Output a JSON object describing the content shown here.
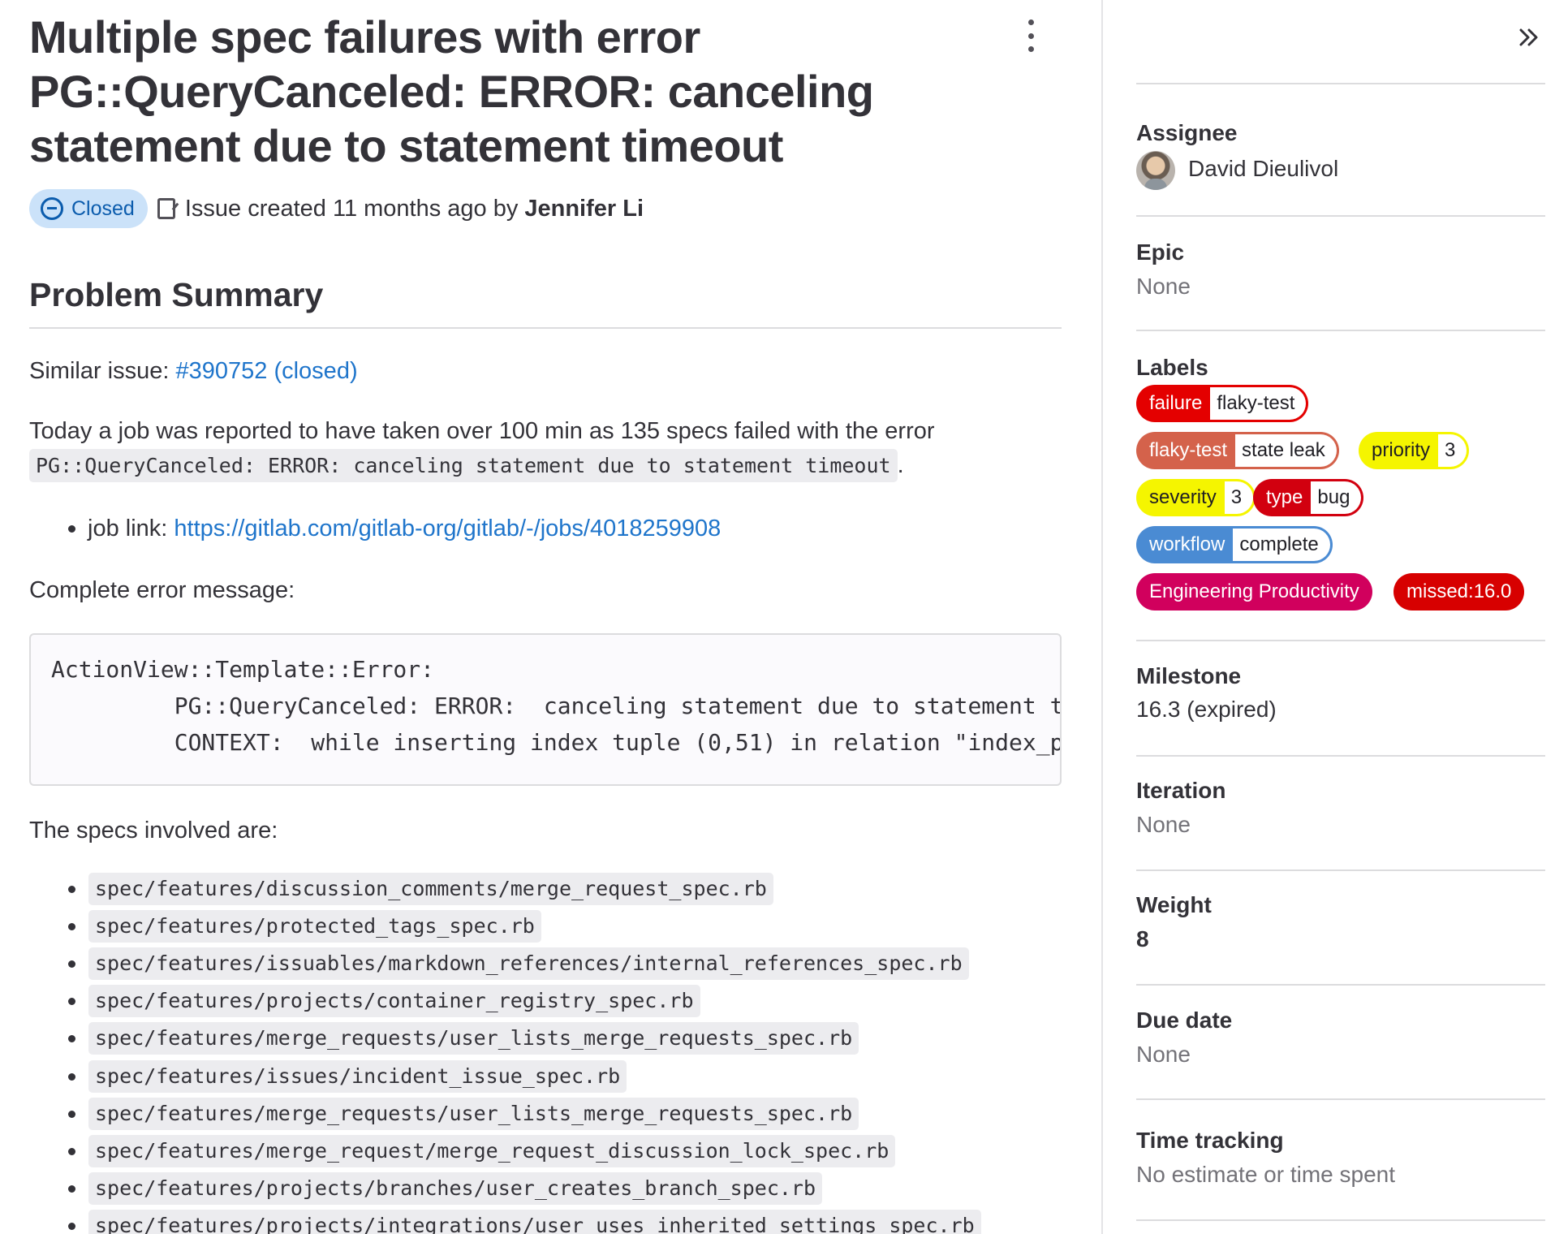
{
  "issue": {
    "title": "Multiple spec failures with error PG::QueryCanceled: ERROR: canceling statement due to statement timeout",
    "status": "Closed",
    "created_text": "Issue created 11 months ago by",
    "author": "Jennifer Li"
  },
  "description": {
    "heading": "Problem Summary",
    "similar_prefix": "Similar issue:",
    "similar_link": "#390752 (closed)",
    "intro_text": "Today a job was reported to have taken over 100 min as 135 specs failed with the error",
    "intro_code": "PG::QueryCanceled: ERROR:  canceling statement due to statement timeout",
    "intro_end": ".",
    "job_prefix": "job link:",
    "job_link": "https://gitlab.com/gitlab-org/gitlab/-/jobs/4018259908",
    "error_heading": "Complete error message:",
    "error_block": "ActionView::Template::Error:\n         PG::QueryCanceled: ERROR:  canceling statement due to statement timeout\n         CONTEXT:  while inserting index tuple (0,51) in relation \"index_p",
    "specs_heading": "The specs involved are:",
    "specs": [
      "spec/features/discussion_comments/merge_request_spec.rb",
      "spec/features/protected_tags_spec.rb",
      "spec/features/issuables/markdown_references/internal_references_spec.rb",
      "spec/features/projects/container_registry_spec.rb",
      "spec/features/merge_requests/user_lists_merge_requests_spec.rb",
      "spec/features/issues/incident_issue_spec.rb",
      "spec/features/merge_requests/user_lists_merge_requests_spec.rb",
      "spec/features/merge_request/merge_request_discussion_lock_spec.rb",
      "spec/features/projects/branches/user_creates_branch_spec.rb",
      "spec/features/projects/integrations/user_uses_inherited_settings_spec.rb"
    ]
  },
  "sidebar": {
    "assignee": {
      "title": "Assignee",
      "value": "David Dieulivol"
    },
    "epic": {
      "title": "Epic",
      "value": "None"
    },
    "labels_title": "Labels",
    "labels": [
      {
        "key": "failure",
        "value": "flaky-test",
        "color": "#e40000"
      },
      {
        "key": "flaky-test",
        "value": "state leak",
        "color": "#d4624b"
      },
      {
        "key": "priority",
        "value": "3",
        "color": "#f5f500"
      },
      {
        "key": "severity",
        "value": "3",
        "color": "#f5f500"
      },
      {
        "key": "type",
        "value": "bug",
        "color": "#d2000f"
      },
      {
        "key": "workflow",
        "value": "complete",
        "color": "#4a8bd3"
      },
      {
        "key": "Engineering Productivity",
        "value": "",
        "color": "#d1005d"
      },
      {
        "key": "missed:16.0",
        "value": "",
        "color": "#d70000"
      }
    ],
    "milestone": {
      "title": "Milestone",
      "value": "16.3 (expired)"
    },
    "iteration": {
      "title": "Iteration",
      "value": "None"
    },
    "weight": {
      "title": "Weight",
      "value": "8"
    },
    "due_date": {
      "title": "Due date",
      "value": "None"
    },
    "time_tracking": {
      "title": "Time tracking",
      "value": "No estimate or time spent"
    }
  }
}
